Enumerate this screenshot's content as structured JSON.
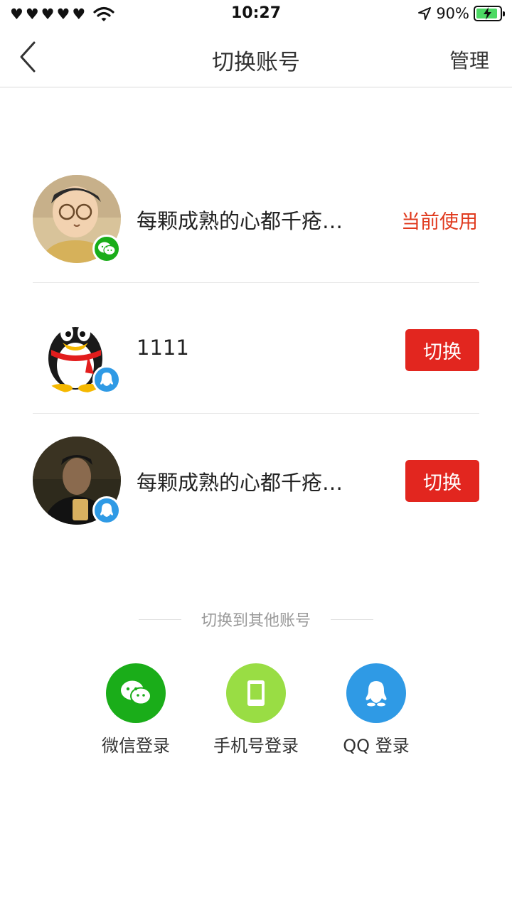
{
  "status_bar": {
    "time": "10:27",
    "battery_percent": "90%",
    "battery_level": 0.9,
    "signal_icon": "heart-signal-icon",
    "wifi_icon": "wifi-icon",
    "location_icon": "location-arrow-icon"
  },
  "nav": {
    "title": "切换账号",
    "manage_label": "管理",
    "back_icon": "chevron-left-icon"
  },
  "accounts": [
    {
      "name": "每颗成熟的心都千疮…",
      "type": "wechat",
      "status": "当前使用"
    },
    {
      "name": "1111",
      "type": "qq",
      "action": "切换"
    },
    {
      "name": "每颗成熟的心都千疮…",
      "type": "qq",
      "action": "切换"
    }
  ],
  "other_accounts": {
    "heading": "切换到其他账号",
    "options": [
      {
        "label": "微信登录",
        "icon": "wechat-icon",
        "color": "#1aad19"
      },
      {
        "label": "手机号登录",
        "icon": "phone-icon",
        "color": "#99dd44"
      },
      {
        "label": "QQ 登录",
        "icon": "qq-icon",
        "color": "#2f9ae5"
      }
    ]
  },
  "colors": {
    "accent_red": "#e2261f",
    "current_text": "#e03a1e"
  }
}
